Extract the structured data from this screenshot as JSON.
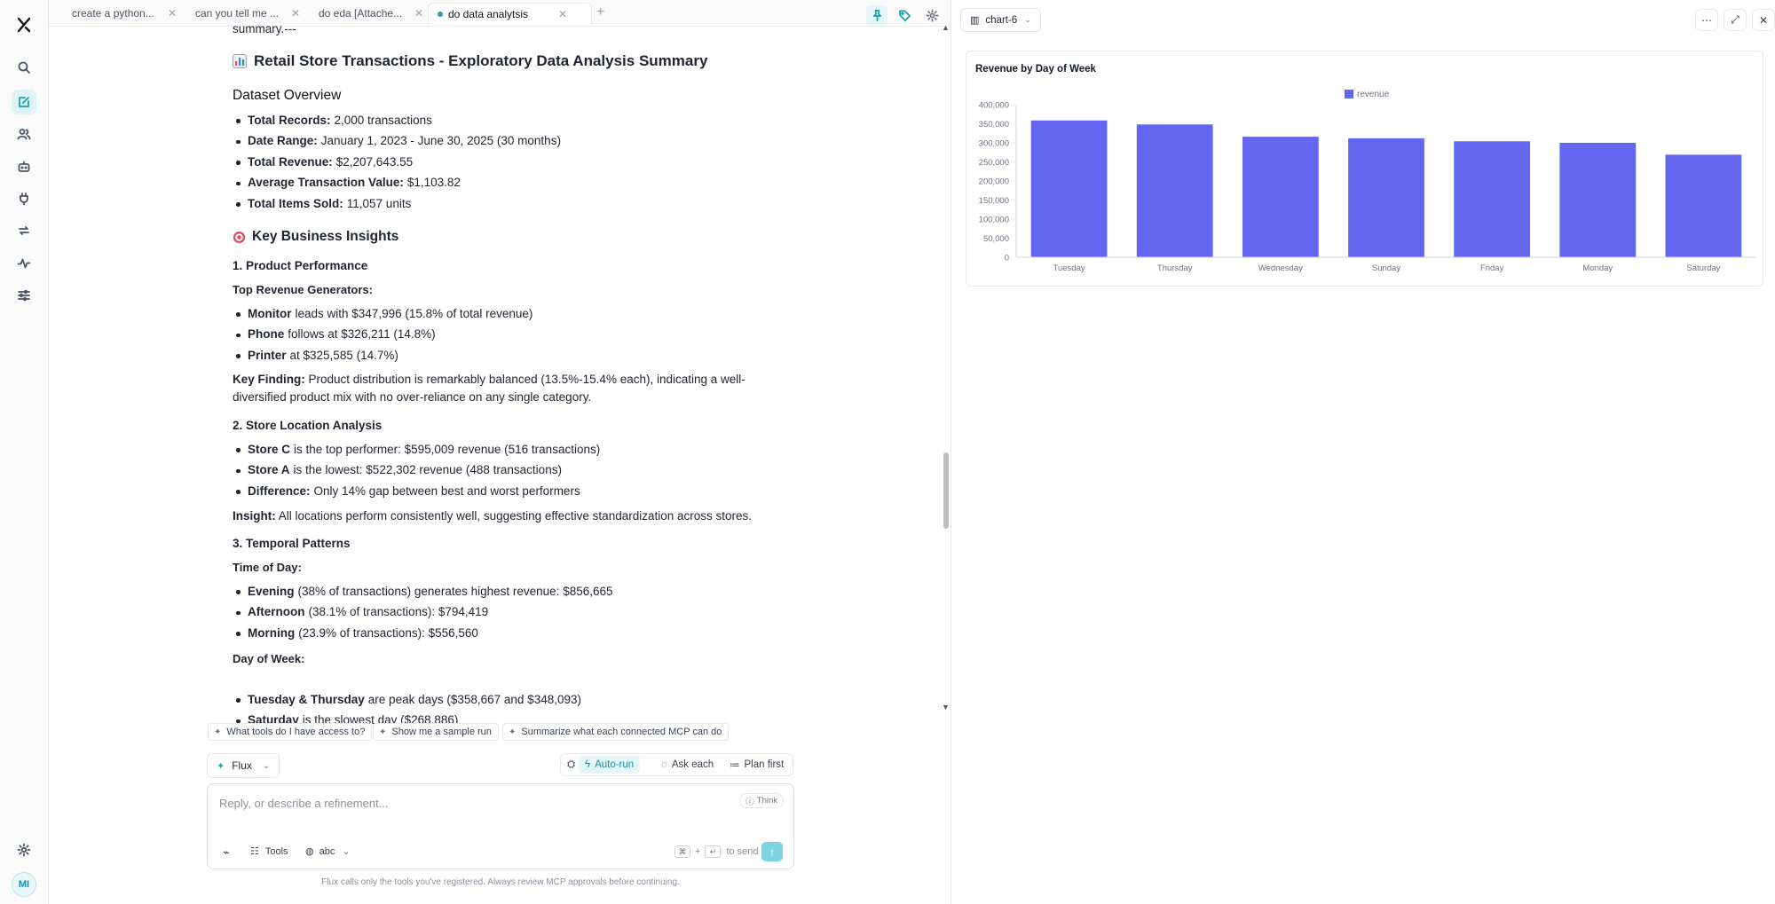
{
  "tabs": [
    {
      "label": "create a python..."
    },
    {
      "label": "can you tell me ..."
    },
    {
      "label": "do eda [Attache..."
    },
    {
      "label": "do data analytsis"
    }
  ],
  "chat": {
    "cut_line": "summary.---",
    "title": "Retail Store Transactions - Exploratory Data Analysis Summary",
    "overview_heading": "Dataset Overview",
    "overview": [
      {
        "k": "Total Records:",
        "v": "2,000 transactions"
      },
      {
        "k": "Date Range:",
        "v": "January 1, 2023 - June 30, 2025 (30 months)"
      },
      {
        "k": "Total Revenue:",
        "v": "$2,207,643.55"
      },
      {
        "k": "Average Transaction Value:",
        "v": "$1,103.82"
      },
      {
        "k": "Total Items Sold:",
        "v": "11,057 units"
      }
    ],
    "insights_heading": "Key Business Insights",
    "s1_heading": "1. Product Performance",
    "s1_sub": "Top Revenue Generators:",
    "s1_items": [
      {
        "k": "Monitor",
        "v": "leads with $347,996 (15.8% of total revenue)"
      },
      {
        "k": "Phone",
        "v": "follows at $326,211 (14.8%)"
      },
      {
        "k": "Printer",
        "v": "at $325,585 (14.7%)"
      }
    ],
    "s1_finding_k": "Key Finding:",
    "s1_finding_v": "Product distribution is remarkably balanced (13.5%-15.4% each), indicating a well-diversified product mix with no over-reliance on any single category.",
    "s2_heading": "2. Store Location Analysis",
    "s2_items": [
      {
        "k": "Store C",
        "v": "is the top performer: $595,009 revenue (516 transactions)"
      },
      {
        "k": "Store A",
        "v": "is the lowest: $522,302 revenue (488 transactions)"
      },
      {
        "k": "Difference:",
        "v": "Only 14% gap between best and worst performers"
      }
    ],
    "s2_insight_k": "Insight:",
    "s2_insight_v": "All locations perform consistently well, suggesting effective standardization across stores.",
    "s3_heading": "3. Temporal Patterns",
    "s3_sub1": "Time of Day:",
    "s3_items1": [
      {
        "k": "Evening",
        "v": "(38% of transactions) generates highest revenue: $856,665"
      },
      {
        "k": "Afternoon",
        "v": "(38.1% of transactions): $794,419"
      },
      {
        "k": "Morning",
        "v": "(23.9% of transactions): $556,560"
      }
    ],
    "s3_sub2": "Day of Week:",
    "s3_items2": [
      {
        "k": "Tuesday & Thursday",
        "v": "are peak days ($358,667 and $348,093)"
      },
      {
        "k": "Saturday",
        "v": "is the slowest day ($268,886)"
      }
    ]
  },
  "suggestions": [
    "What tools do I have access to?",
    "Show me a sample run",
    "Summarize what each connected MCP can do"
  ],
  "composer": {
    "model": "Flux",
    "modes": [
      "Auto-run",
      "Ask each",
      "Plan first"
    ],
    "active_mode": "Auto-run",
    "placeholder": "Reply, or describe a refinement...",
    "think": "Think",
    "tools": "Tools",
    "lang": "abc",
    "send_hint": "to send",
    "footnote": "Flux calls only the tools you've registered. Always review MCP approvals before continuing."
  },
  "user": {
    "initials": "MI"
  },
  "right_panel": {
    "chart_selector": "chart-6"
  },
  "colors": {
    "accent": "#1aa0b3",
    "bar": "#6366f1"
  },
  "chart_data": {
    "type": "bar",
    "title": "Revenue by Day of Week",
    "categories": [
      "Tuesday",
      "Thursday",
      "Wednesday",
      "Sunday",
      "Friday",
      "Monday",
      "Saturday"
    ],
    "series": [
      {
        "name": "revenue",
        "values": [
          358667,
          348093,
          316000,
          312000,
          304000,
          300000,
          268886
        ]
      }
    ],
    "ylim": [
      0,
      400000
    ],
    "yticks": [
      "0",
      "50,000",
      "100,000",
      "150,000",
      "200,000",
      "250,000",
      "300,000",
      "350,000",
      "400,000"
    ],
    "legend": "top-center",
    "grid": false
  }
}
